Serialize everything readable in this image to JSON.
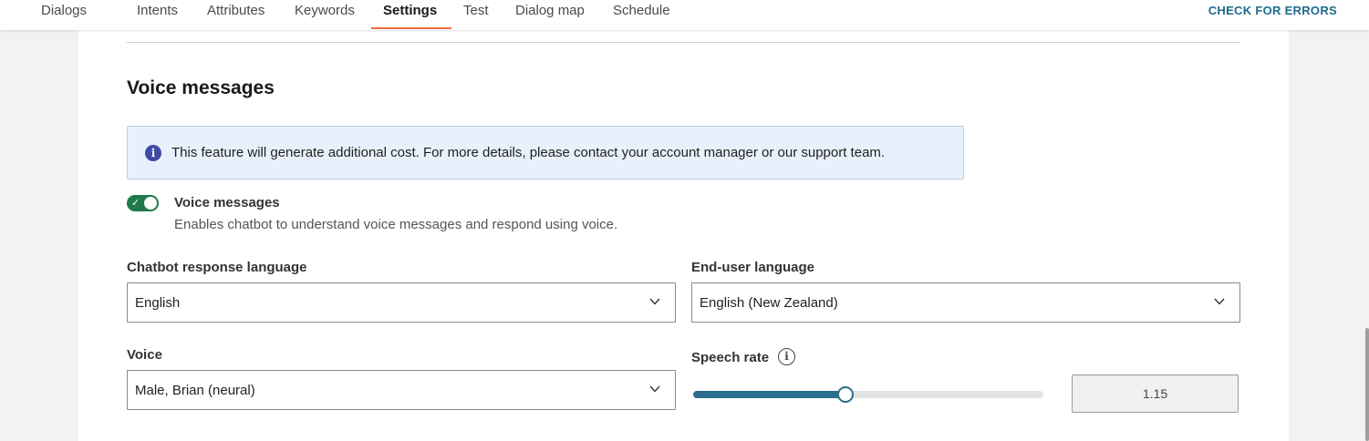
{
  "nav": {
    "tabs": [
      {
        "label": "Dialogs"
      },
      {
        "label": "Intents"
      },
      {
        "label": "Attributes"
      },
      {
        "label": "Keywords"
      },
      {
        "label": "Settings"
      },
      {
        "label": "Test"
      },
      {
        "label": "Dialog map"
      },
      {
        "label": "Schedule"
      }
    ],
    "active_tab": "Settings",
    "check_errors_label": "CHECK FOR ERRORS"
  },
  "section": {
    "title": "Voice messages",
    "info_icon": "info-icon",
    "info_text": "This feature will generate additional cost. For more details, please contact your account manager or our support team."
  },
  "voice_toggle": {
    "on": true,
    "label": "Voice messages",
    "description": "Enables chatbot to understand voice messages and respond using voice."
  },
  "fields": {
    "chatbot_language": {
      "label": "Chatbot response language",
      "value": "English"
    },
    "enduser_language": {
      "label": "End-user language",
      "value": "English (New Zealand)"
    },
    "voice": {
      "label": "Voice",
      "value": "Male, Brian (neural)"
    },
    "speech_rate": {
      "label": "Speech rate",
      "value": "1.15",
      "fraction": 0.436
    }
  },
  "colors": {
    "accent_orange": "#f26b3a",
    "link_blue": "#1d6b8c",
    "toggle_green": "#1e7a4a",
    "slider_blue": "#2b6d8c",
    "info_bg": "#e8f1fb"
  }
}
